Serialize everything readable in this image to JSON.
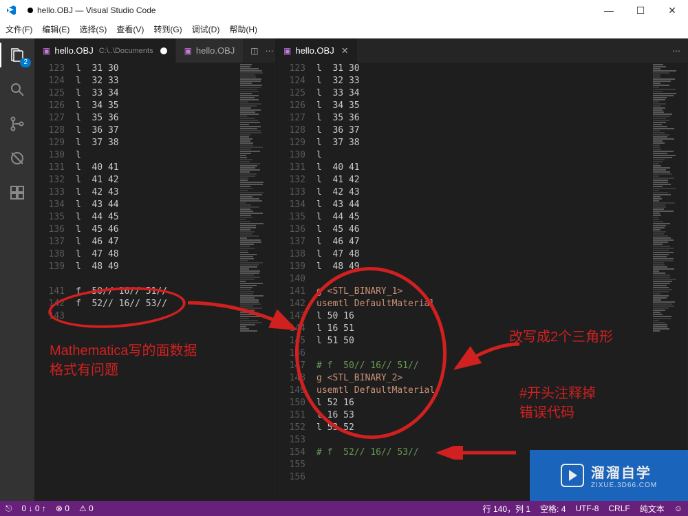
{
  "window": {
    "title": "hello.OBJ — Visual Studio Code",
    "modified_dot": true
  },
  "menu": [
    "文件(F)",
    "编辑(E)",
    "选择(S)",
    "查看(V)",
    "转到(G)",
    "调试(D)",
    "帮助(H)"
  ],
  "activity_badge": "2",
  "editor_left": {
    "tab_label": "hello.OBJ",
    "tab_path": "C:\\..\\Documents",
    "lines_start": 123,
    "lines": [
      "l  31 30",
      "l  32 33",
      "l  33 34",
      "l  34 35",
      "l  35 36",
      "l  36 37",
      "l  37 38",
      "l",
      "l  40 41",
      "l  41 42",
      "l  42 43",
      "l  43 44",
      "l  44 45",
      "l  45 46",
      "l  46 47",
      "l  47 48",
      "l  48 49",
      "",
      "f  50// 16// 51//",
      "f  52// 16// 53//",
      ""
    ]
  },
  "editor_right": {
    "tab_label": "hello.OBJ",
    "lines_start": 123,
    "lines": [
      "l  31 30",
      "l  32 33",
      "l  33 34",
      "l  34 35",
      "l  35 36",
      "l  36 37",
      "l  37 38",
      "l",
      "l  40 41",
      "l  41 42",
      "l  42 43",
      "l  43 44",
      "l  44 45",
      "l  45 46",
      "l  46 47",
      "l  47 48",
      "l  48 49",
      "",
      "g <STL_BINARY_1>",
      "usemtl DefaultMaterial",
      "l 50 16",
      "l 16 51",
      "l 51 50",
      "",
      "# f  50// 16// 51//",
      "g <STL_BINARY_2>",
      "usemtl DefaultMaterial",
      "l 52 16",
      "l 16 53",
      "l 53 52",
      "",
      "# f  52// 16// 53//",
      "",
      ""
    ]
  },
  "annotations": {
    "left_note_1": "Mathematica写的面数据",
    "left_note_2": "格式有问题",
    "right_note_1": "改写成2个三角形",
    "right_note_2a": "#开头注释掉",
    "right_note_2b": "错误代码"
  },
  "status": {
    "branch": "0 ↓ 0 ↑",
    "errors": "⊗ 0",
    "warnings": "⚠ 0",
    "cursor": "行 140，列 1",
    "spaces": "空格: 4",
    "encoding": "UTF-8",
    "eol": "CRLF",
    "lang": "纯文本",
    "feedback": "☺"
  },
  "watermark": {
    "title": "溜溜自学",
    "sub": "ZIXUE.3D66.COM"
  }
}
